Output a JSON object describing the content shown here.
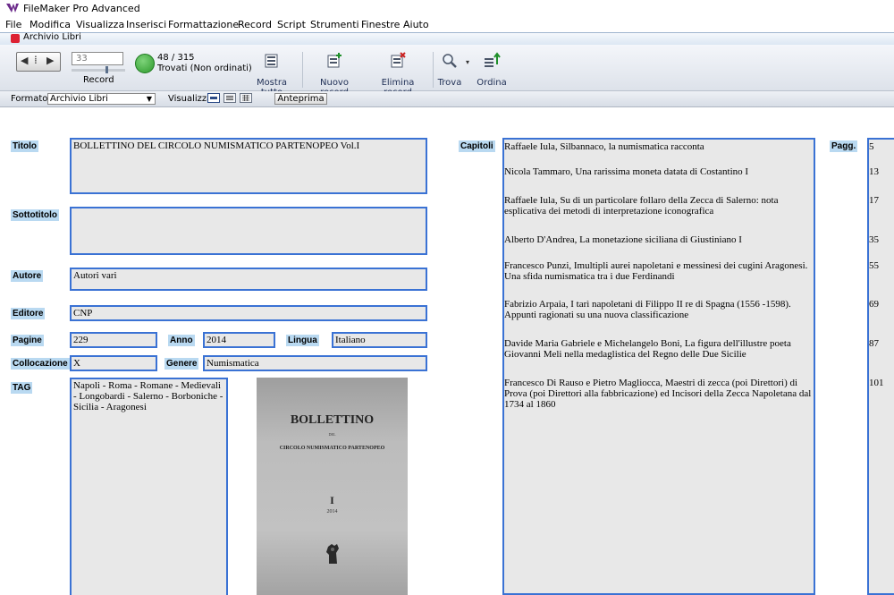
{
  "window": {
    "title": "FileMaker Pro Advanced"
  },
  "menu": [
    "File",
    "Modifica",
    "Visualizza",
    "Inserisci",
    "Formattazione",
    "Record",
    "Script",
    "Strumenti",
    "Finestre",
    "Aiuto"
  ],
  "document": {
    "tab_title": "Archivio Libri"
  },
  "toolbar": {
    "record_number": "33",
    "record_label": "Record",
    "found_count": "48 / 315",
    "found_status": "Trovati (Non ordinati)",
    "show_all": "Mostra tutto",
    "new_record": "Nuovo record",
    "delete_record": "Elimina record",
    "find": "Trova",
    "sort": "Ordina"
  },
  "layoutbar": {
    "format_label": "Formato:",
    "format_value": "Archivio Libri",
    "view_label": "Visualizza:",
    "preview_button": "Anteprima"
  },
  "record": {
    "labels": {
      "title": "Titolo",
      "subtitle": "Sottotitolo",
      "author": "Autore",
      "publisher": "Editore",
      "pages": "Pagine",
      "year": "Anno",
      "language": "Lingua",
      "location": "Collocazione",
      "genre": "Genere",
      "tags": "TAG",
      "chapters": "Capitoli",
      "page_refs": "Pagg."
    },
    "title": "BOLLETTINO DEL CIRCOLO NUMISMATICO PARTENOPEO   Vol.I",
    "subtitle": "",
    "author": "Autori vari",
    "publisher": "CNP",
    "pages": "229",
    "year": "2014",
    "language": "Italiano",
    "location": "X",
    "genre": "Numismatica",
    "tags": "Napoli - Roma - Romane - Medievali - Longobardi - Salerno - Borboniche - Sicilia - Aragonesi",
    "cover": {
      "line1": "BOLLETTINO",
      "line2": "DEL",
      "line3": "CIRCOLO NUMISMATICO PARTENOPEO",
      "line4": "I",
      "line5": "2014"
    },
    "chapters": [
      "Raffaele Iula, Silbannaco, la numismatica racconta",
      "Nicola Tammaro, Una rarissima moneta datata di Costantino I",
      "Raffaele Iula, Su di un particolare follaro della Zecca di Salerno: nota esplicativa dei metodi di interpretazione iconografica",
      "Alberto D'Andrea, La monetazione siciliana di Giustiniano I",
      "Francesco Punzi, Imultipli aurei napoletani e messinesi dei cugini Aragonesi. Una sfida numismatica tra i due Ferdinandi",
      "Fabrizio Arpaia, I tarì napoletani di Filippo II re di Spagna (1556 -1598). Appunti ragionati su una nuova classificazione",
      "Davide Maria Gabriele e Michelangelo Boni, La figura dell'illustre poeta Giovanni Meli nella medaglistica del Regno delle Due Sicilie",
      "Francesco Di Rauso e Pietro Magliocca, Maestri di zecca (poi Direttori) di Prova (poi Direttori alla fabbricazione) ed Incisori della Zecca Napoletana dal 1734 al 1860"
    ],
    "page_refs": [
      "5",
      "13",
      "17",
      "35",
      "55",
      "69",
      "87",
      "101"
    ]
  },
  "colors": {
    "label_bg": "#b9d9f1",
    "field_border": "#3a72d4",
    "field_bg": "#e8e8e8",
    "found_indicator": "#2d9a2c"
  }
}
